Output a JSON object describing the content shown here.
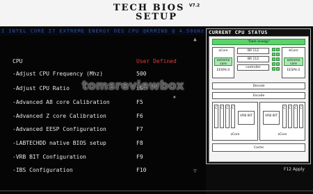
{
  "header": {
    "title": "TECH BIOS",
    "version": "V7.2",
    "subtitle": "SETUP"
  },
  "cpu_info_line": "I INTEL CORE I7 EXTREME ENERGY OES CPU @KRMIND @ 4.50GHz",
  "menu": {
    "items": [
      {
        "label": "CPU",
        "value": "User Defined"
      },
      {
        "label": "-Adjust CPU Frequency (Mhz)",
        "value": "500"
      },
      {
        "label": "-Adjust CPU Ratio",
        "value": "x9"
      },
      {
        "label": "-Advanced A8 core Calibration",
        "value": "F5"
      },
      {
        "label": "-Advanced Z core Calibration",
        "value": "F6"
      },
      {
        "label": "-Advanced EESP Configuration",
        "value": "F7"
      },
      {
        "label": "-LABTECHDD native BIOS setup",
        "value": "F8"
      },
      {
        "label": "-VRB BIT Configuration",
        "value": "F9"
      },
      {
        "label": "-IBS Configuration",
        "value": "F10"
      }
    ],
    "scroll_up": "▲",
    "scroll_down": "▽",
    "cursor": "⏸"
  },
  "watermark": "tomsreviewbox",
  "status_panel": {
    "title": "CURRENT CPU STATUS",
    "top_bar": "\"Dark energy\"",
    "acore": "aCore",
    "bcore": "bCore",
    "extreme_core_left": "extreme core",
    "extreme_core_right": "extreme core",
    "eesp_left": "EESP4.0",
    "eesp_right": "EESP4.0",
    "center_rows": [
      "BR 112",
      "BR 112",
      "controller"
    ],
    "decode": "Decode",
    "encode": "Encode",
    "vrb_left": "VRB BIT",
    "vrb_right": "VRB BIT",
    "zcore_left": "zCore",
    "zcore_right": "zCore",
    "cache": "Cache",
    "c_label": "C"
  },
  "footer": {
    "apply_hint": "F12 Apply"
  },
  "colors": {
    "header_bg": "#f4f4f4",
    "highlight_value": "#e23b3b",
    "accent_green": "#59d46a"
  }
}
